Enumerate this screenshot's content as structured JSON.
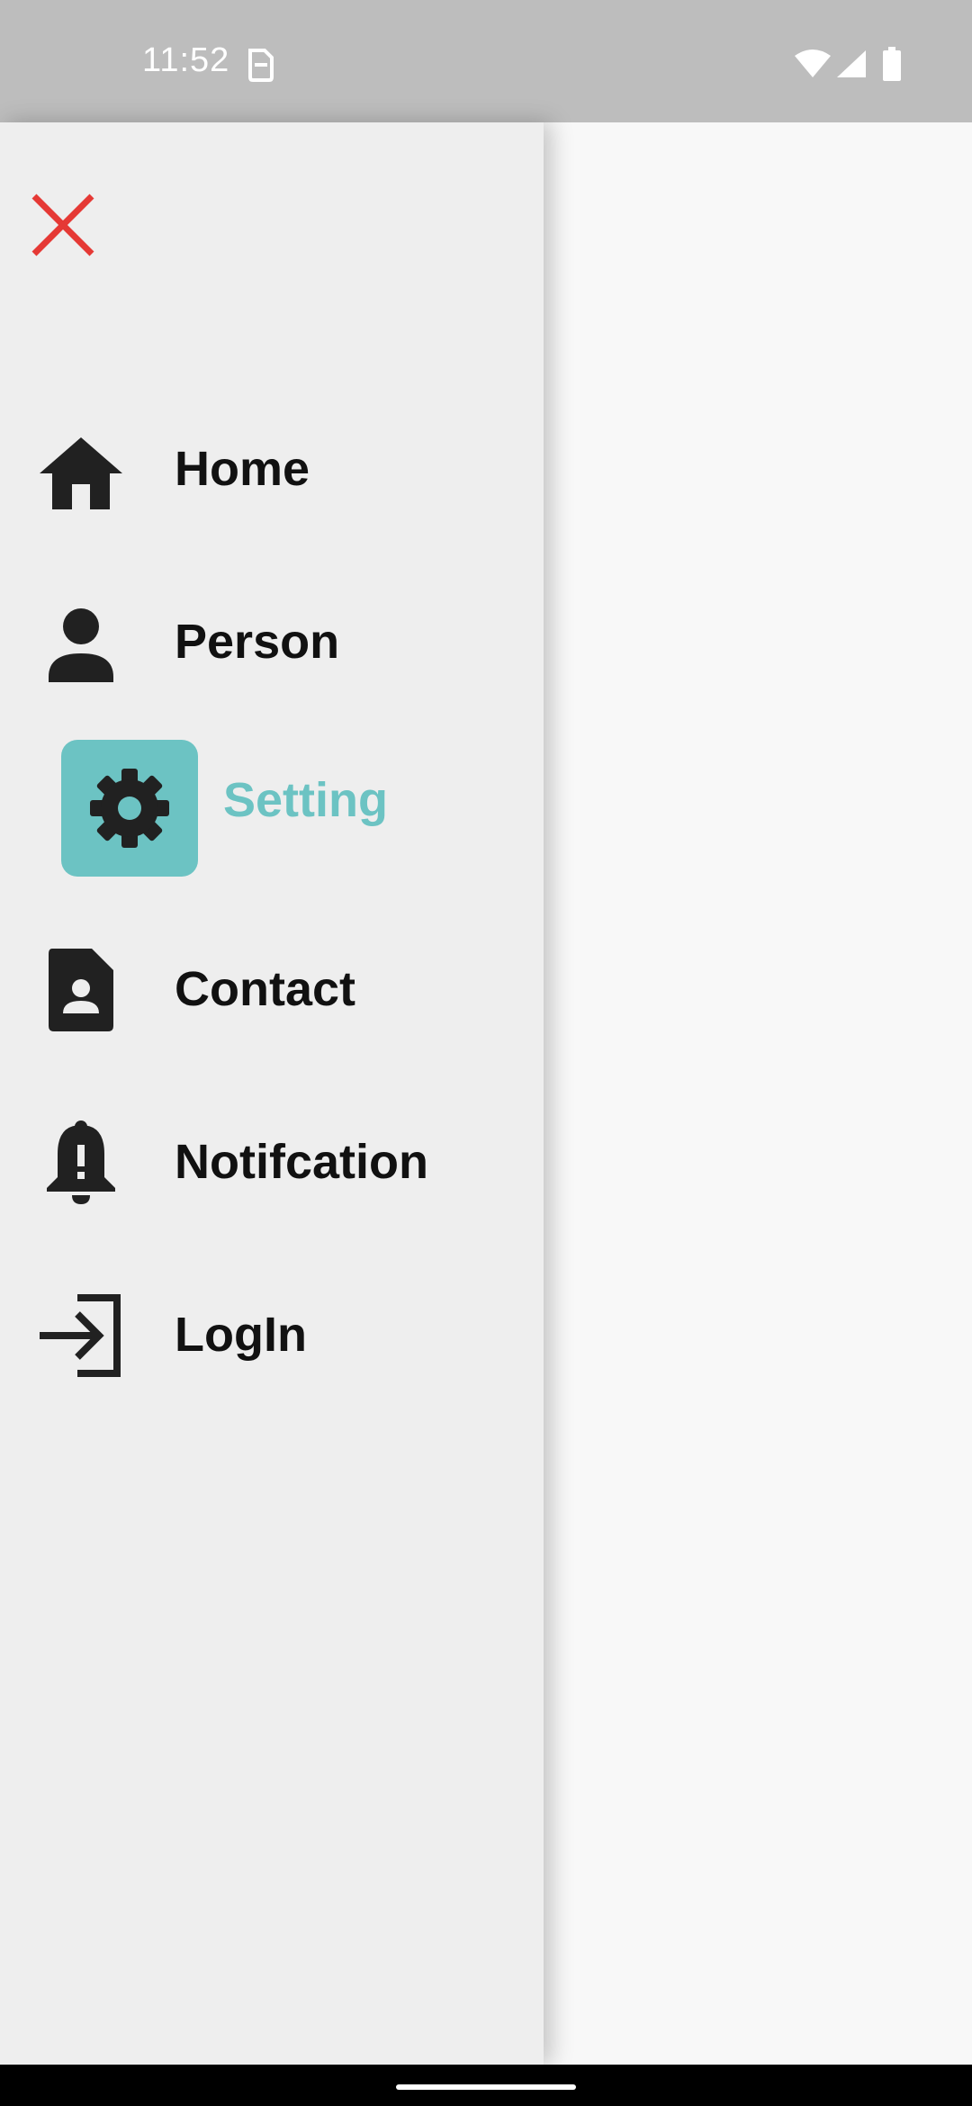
{
  "status_bar": {
    "time": "11:52",
    "icons": [
      "sim-card-icon",
      "wifi-icon",
      "signal-icon",
      "battery-icon"
    ]
  },
  "drawer": {
    "close_icon": "close-icon",
    "close_color": "#e53935",
    "accent_color": "#6cc3c3",
    "items": [
      {
        "label": "Home",
        "icon": "home-icon",
        "active": false
      },
      {
        "label": "Person",
        "icon": "person-icon",
        "active": false
      },
      {
        "label": "Setting",
        "icon": "gear-icon",
        "active": true
      },
      {
        "label": "Contact",
        "icon": "contact-icon",
        "active": false
      },
      {
        "label": "Notifcation",
        "icon": "notification-bell-icon",
        "active": false
      },
      {
        "label": "LogIn",
        "icon": "login-icon",
        "active": false
      }
    ]
  }
}
